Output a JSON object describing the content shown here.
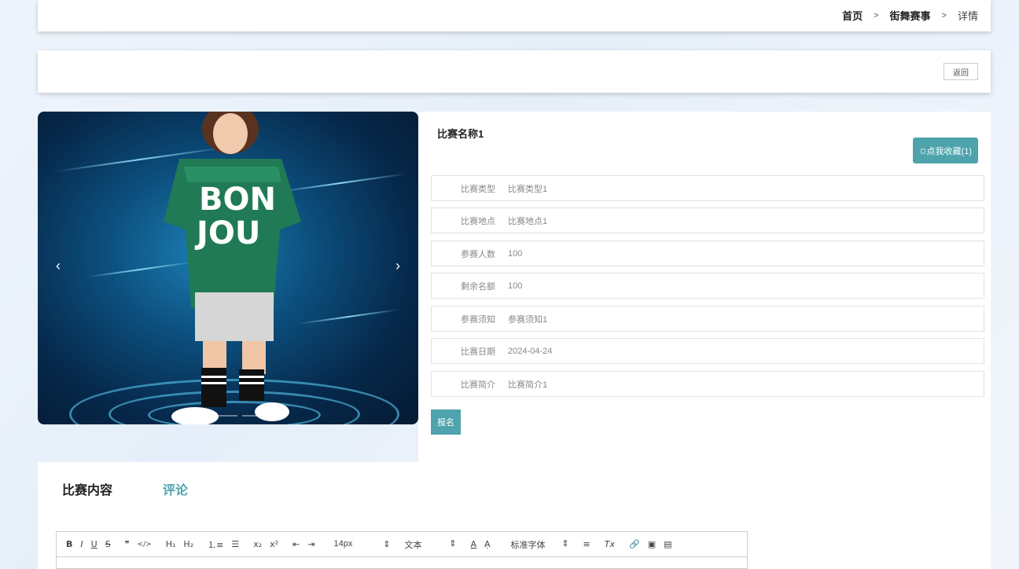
{
  "breadcrumb": {
    "home": "首页",
    "sep1": ">",
    "section": "街舞赛事",
    "sep2": ">",
    "current": "详情"
  },
  "toolbar": {
    "back_label": "返回"
  },
  "carousel": {
    "prev": "‹",
    "next": "›",
    "active_slide": 1,
    "slide_count": 4
  },
  "contest": {
    "title": "比赛名称1",
    "favorite_label": "✩点我收藏(1)",
    "fields": [
      {
        "key": "比赛类型",
        "value": "比赛类型1"
      },
      {
        "key": "比赛地点",
        "value": "比赛地点1"
      },
      {
        "key": "参赛人数",
        "value": "100"
      },
      {
        "key": "剩余名额",
        "value": "100"
      },
      {
        "key": "参赛须知",
        "value": "参赛须知1"
      },
      {
        "key": "比赛日期",
        "value": "2024-04-24"
      },
      {
        "key": "比赛简介",
        "value": "比赛简介1"
      }
    ],
    "signup_label": "报名"
  },
  "tabs": {
    "content": "比赛内容",
    "comment": "评论"
  },
  "editor": {
    "bold": "B",
    "italic": "I",
    "underline": "U",
    "strike": "S",
    "quote": "❞",
    "code": "</>",
    "h1": "H₁",
    "h2": "H₂",
    "ol": "⒈≡",
    "ul": "☰",
    "sub": "x₂",
    "sup": "x²",
    "outdent": "⇤",
    "indent": "⇥",
    "size": "14px",
    "type": "文本",
    "font": "标准字体",
    "color": "A",
    "bg": "Ạ",
    "align": "≡",
    "clean": "Tx",
    "link": "🔗",
    "image": "▣",
    "video": "▤",
    "caret": "⇕"
  }
}
